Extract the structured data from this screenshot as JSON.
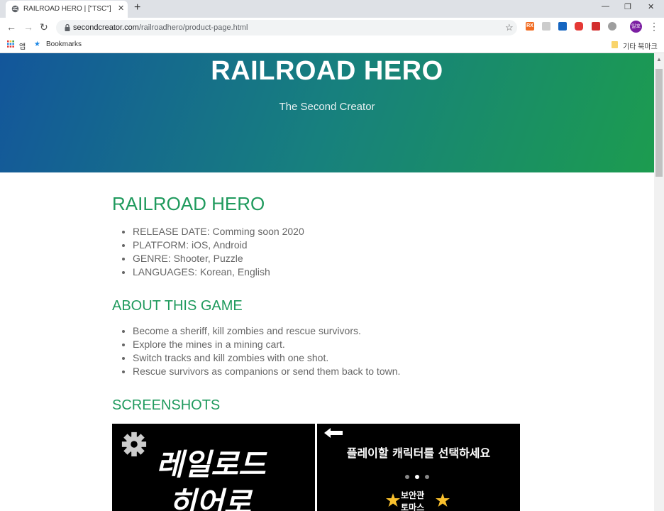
{
  "browser": {
    "tab_title": "RAILROAD HERO | [\"TSC\"]",
    "url_domain": "secondcreator.com",
    "url_path": "/railroadhero/product-page.html",
    "bookmarks": {
      "apps_label": "앱",
      "bookmarks_label": "Bookmarks",
      "other_label": "기타 북마크"
    },
    "profile_label": "일호",
    "extensions": [
      "RX"
    ]
  },
  "hero": {
    "title": "RAILROAD HERO",
    "subtitle": "The Second Creator",
    "gradient_colors": [
      "#13569b",
      "#1c9c4f"
    ]
  },
  "main": {
    "product_title": "RAILROAD HERO",
    "info": [
      "RELEASE DATE: Comming soon 2020",
      "PLATFORM: iOS, Android",
      "GENRE: Shooter, Puzzle",
      "LANGUAGES: Korean, English"
    ],
    "about_heading": "ABOUT THIS GAME",
    "about": [
      "Become a sheriff, kill zombies and rescue survivors.",
      "Explore the mines in a mining cart.",
      "Switch tracks and kill zombies with one shot.",
      "Rescue survivors as companions or send them back to town."
    ],
    "screenshots_heading": "SCREENSHOTS",
    "accent_color": "#1f9a5d"
  },
  "screenshots": {
    "shot1": {
      "line1": "레일로드",
      "line2": "히어로"
    },
    "shot2": {
      "heading": "플레이할 캐릭터를 선택하세요",
      "char_line1": "보안관",
      "char_line2": "토마스"
    }
  }
}
